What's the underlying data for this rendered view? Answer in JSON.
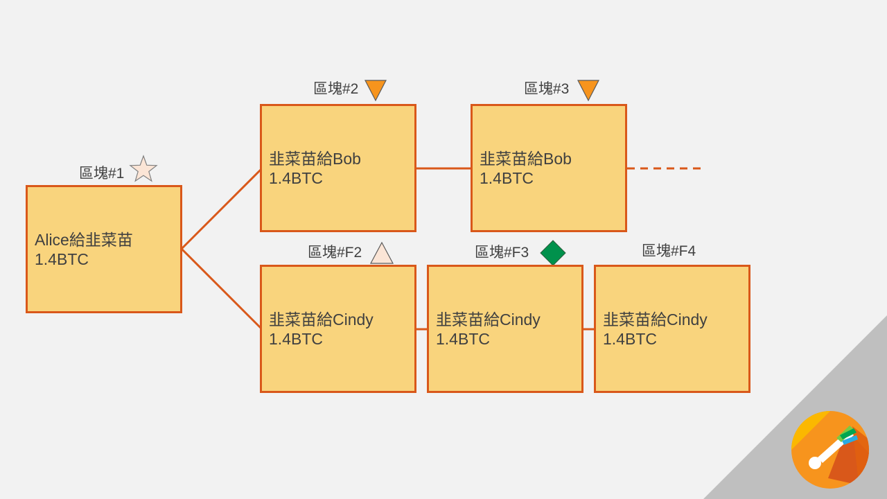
{
  "blocks": {
    "b1": {
      "label": "區塊#1",
      "line1": "Alice給韭菜苗",
      "line2": "1.4BTC",
      "marker": "star-icon"
    },
    "b2": {
      "label": "區塊#2",
      "line1": "韭菜苗給Bob",
      "line2": "1.4BTC",
      "marker": "down-triangle-icon"
    },
    "b3": {
      "label": "區塊#3",
      "line1": "韭菜苗給Bob",
      "line2": "1.4BTC",
      "marker": "down-triangle-icon"
    },
    "bf2": {
      "label": "區塊#F2",
      "line1": "韭菜苗給Cindy",
      "line2": "1.4BTC",
      "marker": "up-triangle-icon"
    },
    "bf3": {
      "label": "區塊#F3",
      "line1": "韭菜苗給Cindy",
      "line2": "1.4BTC",
      "marker": "diamond-icon"
    },
    "bf4": {
      "label": "區塊#F4",
      "line1": "韭菜苗給Cindy",
      "line2": "1.4BTC",
      "marker": ""
    }
  },
  "colors": {
    "block_fill": "#f9d47d",
    "block_border": "#d9581a",
    "down_triangle": "#f7941d",
    "up_triangle": "#fbe5d6",
    "star": "#fbe5d6",
    "diamond": "#00914c",
    "corner": "#bfbfbf"
  },
  "logo": {
    "name": "leek-logo-icon"
  }
}
